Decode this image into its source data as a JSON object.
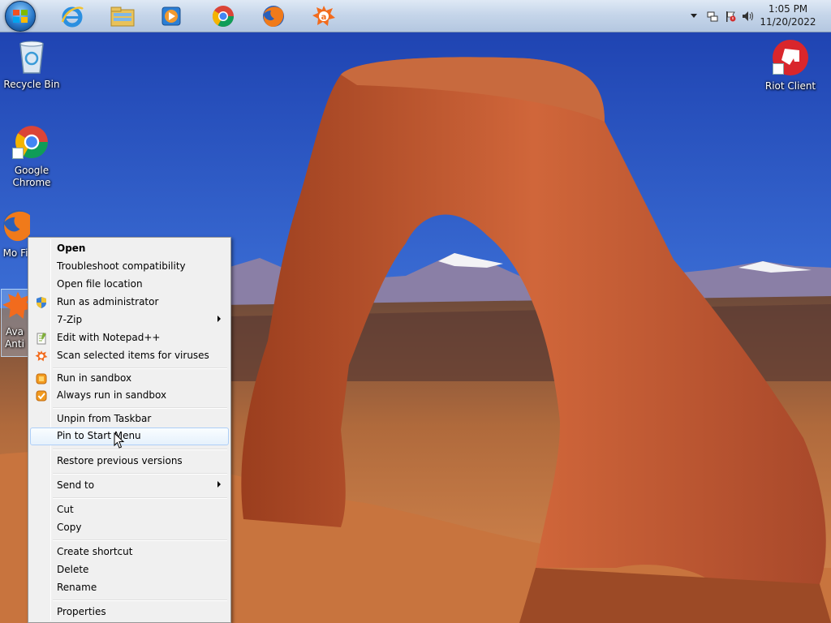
{
  "taskbar": {
    "pinned": [
      {
        "name": "start-orb"
      },
      {
        "name": "internet-explorer"
      },
      {
        "name": "windows-explorer"
      },
      {
        "name": "media-player"
      },
      {
        "name": "google-chrome"
      },
      {
        "name": "firefox"
      },
      {
        "name": "avast"
      }
    ],
    "clock": {
      "time": "1:05 PM",
      "date": "11/20/2022"
    }
  },
  "desktop": {
    "icons": [
      {
        "label": "Recycle Bin"
      },
      {
        "label": "Google Chrome"
      },
      {
        "label": "Mo Fi"
      },
      {
        "label": "Ava Anti"
      },
      {
        "label": "Riot Client"
      }
    ]
  },
  "context_menu": {
    "items": [
      {
        "label": "Open",
        "bold": true
      },
      {
        "label": "Troubleshoot compatibility"
      },
      {
        "label": "Open file location"
      },
      {
        "label": "Run as administrator",
        "icon": "uac-shield-icon"
      },
      {
        "label": "7-Zip",
        "submenu": true
      },
      {
        "label": "Edit with Notepad++",
        "icon": "notepadpp-icon"
      },
      {
        "label": "Scan selected items for viruses",
        "icon": "avast-icon"
      },
      {
        "label": "Run in sandbox",
        "icon": "sandbox-icon"
      },
      {
        "label": "Always run in sandbox",
        "icon": "sandbox-check-icon"
      },
      {
        "label": "Unpin from Taskbar"
      },
      {
        "label": "Pin to Start Menu",
        "highlighted": true
      },
      {
        "label": "Restore previous versions"
      },
      {
        "label": "Send to",
        "submenu": true
      },
      {
        "label": "Cut"
      },
      {
        "label": "Copy"
      },
      {
        "label": "Create shortcut"
      },
      {
        "label": "Delete"
      },
      {
        "label": "Rename"
      },
      {
        "label": "Properties"
      }
    ]
  },
  "colors": {
    "taskbar": "#c6d6ea",
    "menu_bg": "#f0f0f0",
    "menu_hover": "#e6f1fc",
    "sky": "#2f5fc4",
    "rock": "#c0552a"
  }
}
